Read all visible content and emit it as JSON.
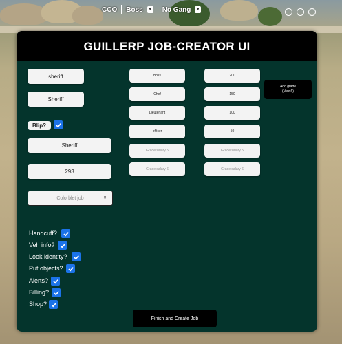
{
  "hud": {
    "player_id": "CCO",
    "job": "Boss",
    "gang": "No Gang"
  },
  "panel": {
    "title": "GUILLERP JOB-CREATOR UI"
  },
  "left": {
    "job_name_value": "sheriff",
    "job_label_value": "Sheriff",
    "blip_label": "Blip?",
    "blip_checked": true,
    "blip_name_value": "Sheriff",
    "blip_sprite_value": "293",
    "color_select_placeholder": "Colorblet job",
    "color_select_arrow": "⬍"
  },
  "grades": [
    {
      "name": "Boss",
      "salary": "200"
    },
    {
      "name": "Chef",
      "salary": "150"
    },
    {
      "name": "Lieutenant",
      "salary": "100"
    },
    {
      "name": "officer",
      "salary": "50"
    },
    {
      "name": "Grade salary 5",
      "salary": "Grade salary 5"
    },
    {
      "name": "Grade salary 6",
      "salary": "Grade salary 6"
    }
  ],
  "add_grade": {
    "line1": "Add grade",
    "line2": "(Max 6)"
  },
  "permissions": [
    {
      "label": "Handcuff?",
      "checked": true
    },
    {
      "label": "Veh info?",
      "checked": true
    },
    {
      "label": "Look identity?",
      "checked": true
    },
    {
      "label": "Put objects?",
      "checked": true
    },
    {
      "label": "Alerts?",
      "checked": true
    },
    {
      "label": "Billing?",
      "checked": true
    },
    {
      "label": "Shop?",
      "checked": true
    }
  ],
  "finish_label": "Finish and Create Job",
  "colors": {
    "panel_bg": "#04342c",
    "header_bg": "#000000",
    "checkbox": "#1b73e8"
  }
}
